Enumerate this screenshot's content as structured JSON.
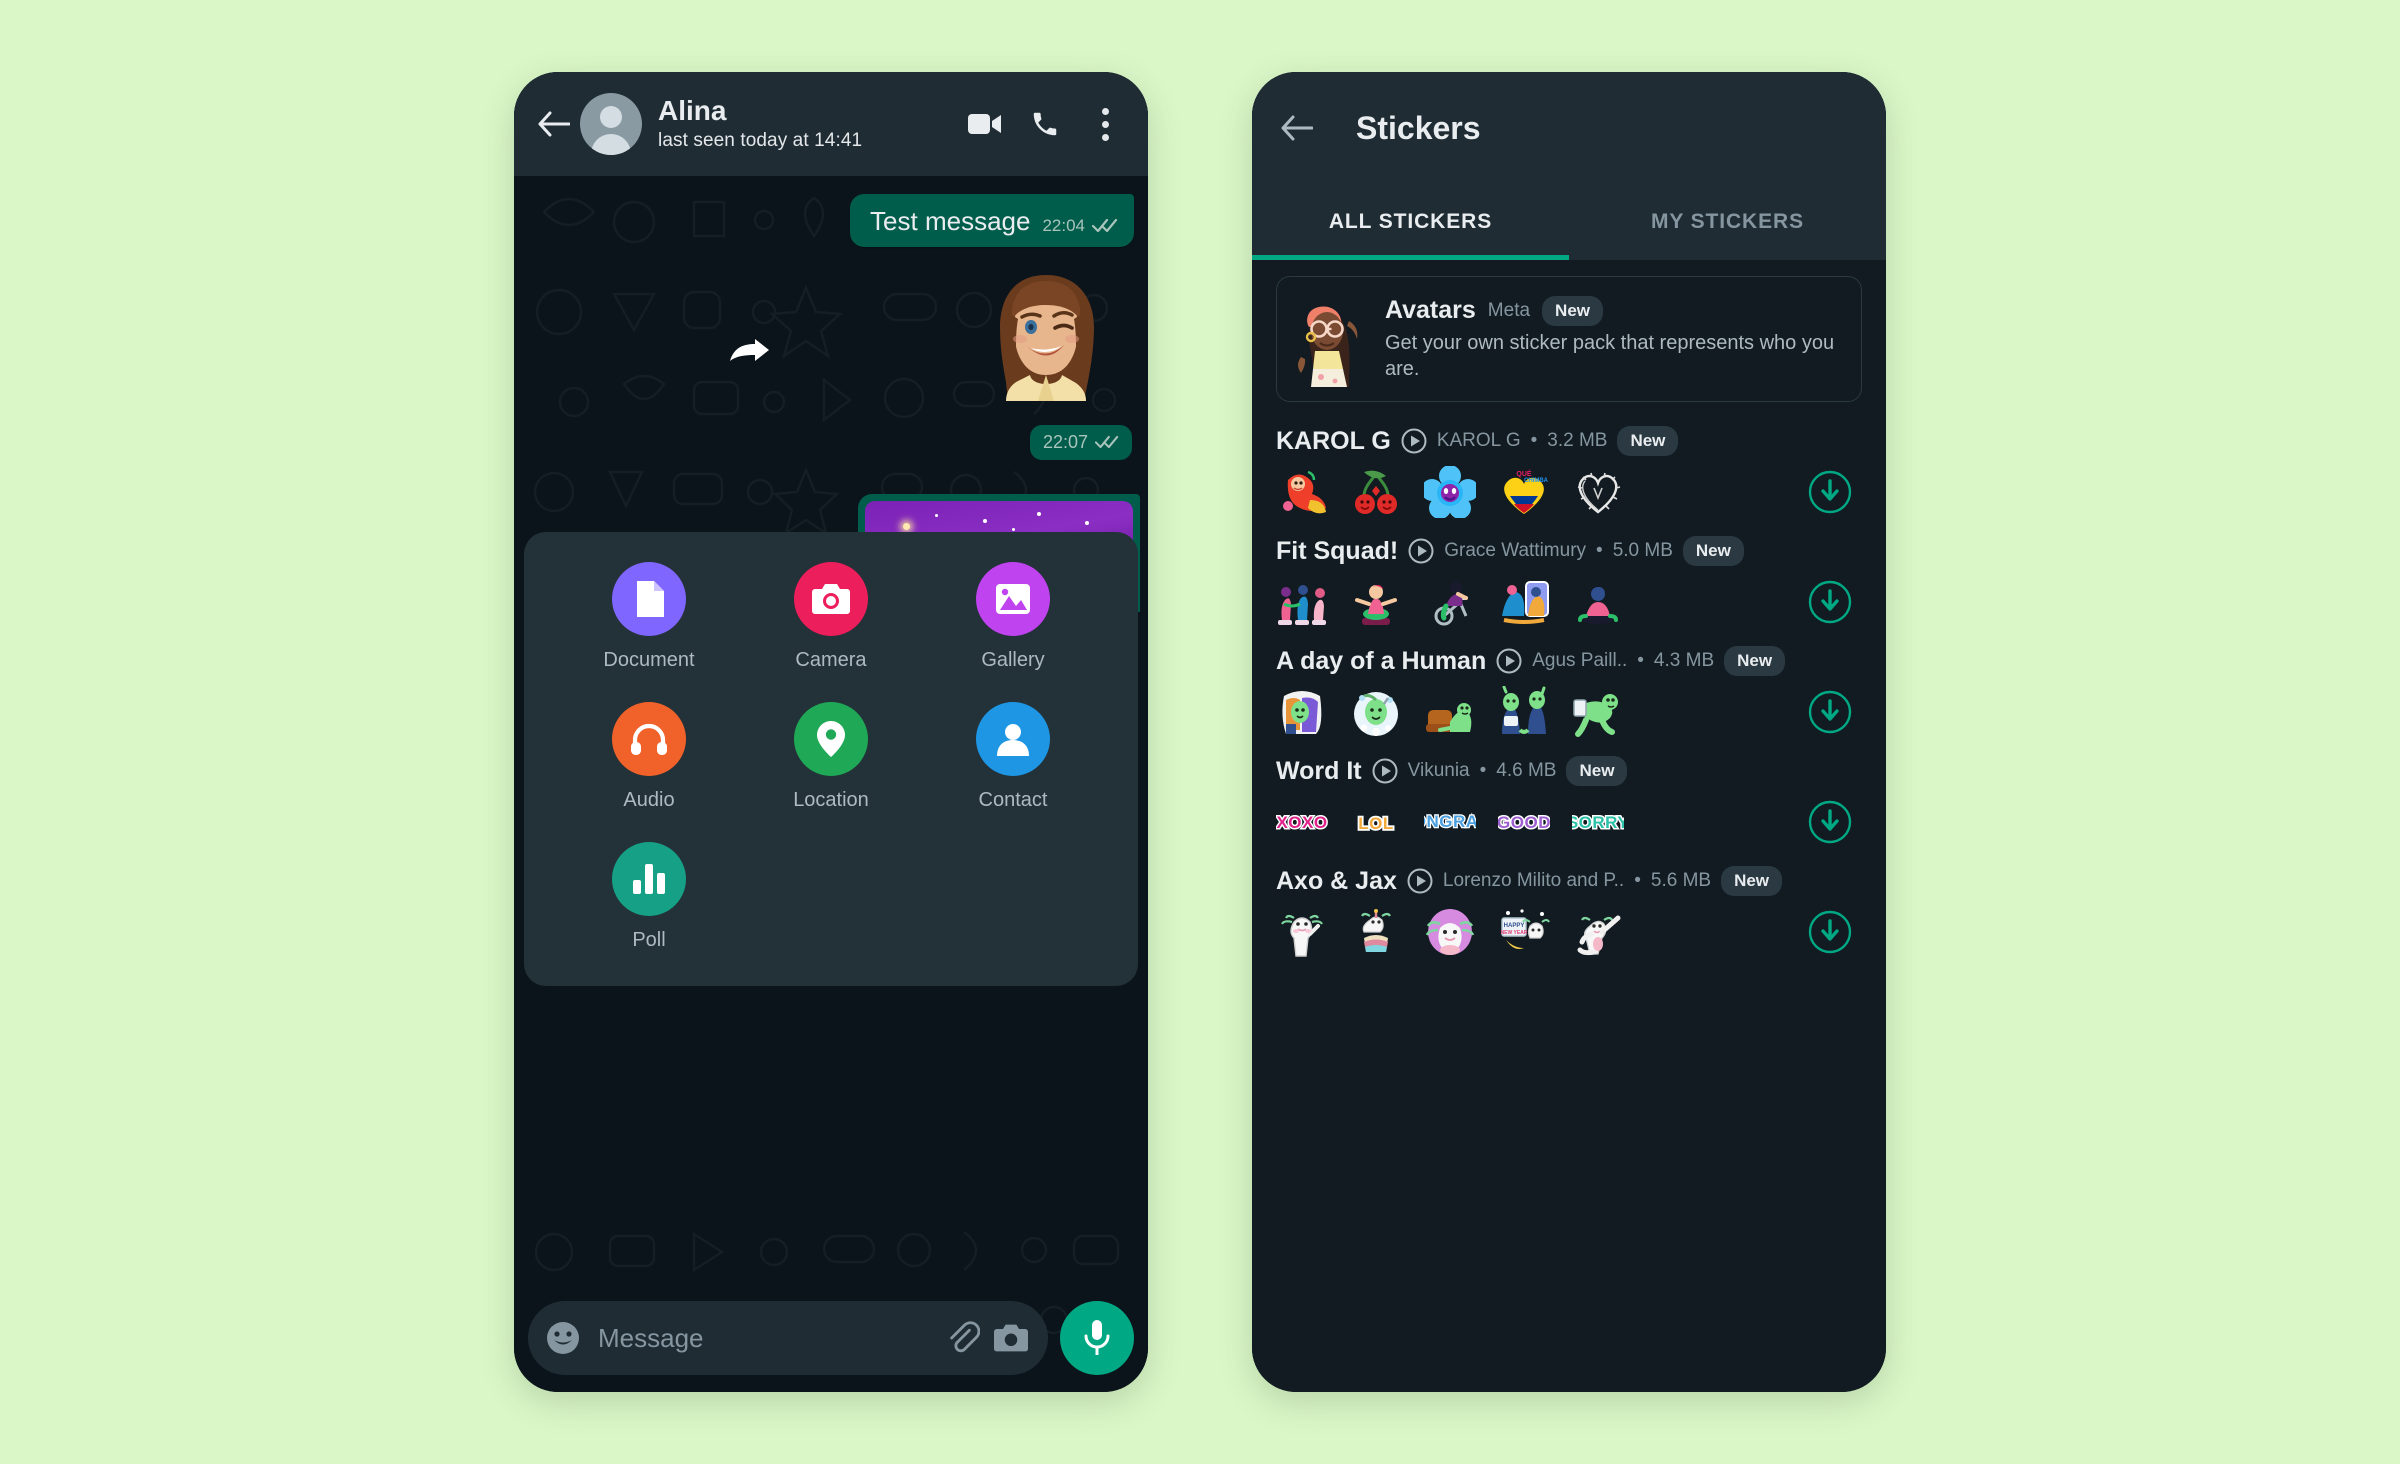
{
  "background_color": "#daf7c8",
  "chat": {
    "header": {
      "back_icon": "arrow-left-icon",
      "avatar": "contact-avatar",
      "name": "Alina",
      "status": "last seen today at 14:41",
      "video_call_icon": "video-camera-icon",
      "voice_call_icon": "phone-icon",
      "menu_icon": "kebab-menu-icon"
    },
    "messages": [
      {
        "type": "text",
        "text": "Test message",
        "time": "22:04",
        "status": "read",
        "outgoing": true
      },
      {
        "type": "sticker",
        "sticker": "avatar-sticker-wink",
        "time": "22:07",
        "status": "read",
        "outgoing": true,
        "forwarded_icon": "forward-arrow-icon"
      },
      {
        "type": "image",
        "image": "purple-starry-night-photo",
        "outgoing": true
      }
    ],
    "attachment_menu": {
      "items": [
        {
          "label": "Document",
          "icon": "document-icon",
          "color": "#7f66ff"
        },
        {
          "label": "Camera",
          "icon": "camera-icon",
          "color": "#ec1e5b"
        },
        {
          "label": "Gallery",
          "icon": "gallery-icon",
          "color": "#c043f0"
        },
        {
          "label": "Audio",
          "icon": "headphones-icon",
          "color": "#f1622a"
        },
        {
          "label": "Location",
          "icon": "location-pin-icon",
          "color": "#1fa855"
        },
        {
          "label": "Contact",
          "icon": "contact-person-icon",
          "color": "#1e96e4"
        },
        {
          "label": "Poll",
          "icon": "poll-bar-chart-icon",
          "color": "#16a085"
        }
      ]
    },
    "input_bar": {
      "emoji_icon": "emoji-smiley-icon",
      "placeholder": "Message",
      "attach_icon": "paperclip-icon",
      "camera_icon": "camera-icon",
      "mic_icon": "microphone-icon",
      "mic_color": "#00a884"
    }
  },
  "stickers": {
    "header": {
      "back_icon": "arrow-left-icon",
      "title": "Stickers"
    },
    "tabs": [
      {
        "label": "ALL STICKERS",
        "active": true
      },
      {
        "label": "MY STICKERS",
        "active": false
      }
    ],
    "accent_color": "#00a884",
    "avatars_card": {
      "thumb": "avatar-girl-thumbnail",
      "title": "Avatars",
      "publisher": "Meta",
      "badge": "New",
      "description": "Get your own sticker pack that represents who you are."
    },
    "packs": [
      {
        "name": "KAROL G",
        "play_icon": "play-circle-icon",
        "author": "KAROL G",
        "separator": "•",
        "size": "3.2 MB",
        "badge": "New",
        "download_icon": "download-circle-icon",
        "thumbs": [
          "mermaid-sticker",
          "cherries-sticker",
          "blue-flower-sticker",
          "que-chimba-heart-sticker",
          "thorn-heart-sticker"
        ]
      },
      {
        "name": "Fit Squad!",
        "play_icon": "play-circle-icon",
        "author": "Grace Wattimury",
        "separator": "•",
        "size": "5.0 MB",
        "badge": "New",
        "download_icon": "download-circle-icon",
        "thumbs": [
          "gym-trio-sticker",
          "stretching-sticker",
          "spin-bike-sticker",
          "phone-workout-sticker",
          "yoga-sticker"
        ]
      },
      {
        "name": "A day of a Human",
        "play_icon": "play-circle-icon",
        "author": "Agus Paill..",
        "separator": "•",
        "size": "4.3 MB",
        "badge": "New",
        "download_icon": "download-circle-icon",
        "thumbs": [
          "green-person-bus-sticker",
          "green-person-shower-sticker",
          "green-person-sofa-sticker",
          "green-people-pair-sticker",
          "green-person-running-sticker"
        ]
      },
      {
        "name": "Word It",
        "play_icon": "play-circle-icon",
        "author": "Vikunia",
        "separator": "•",
        "size": "4.6 MB",
        "badge": "New",
        "download_icon": "download-circle-icon",
        "thumbs": [
          "XOXO",
          "LOL",
          "CONGRATS",
          "GOOD",
          "SORRY"
        ]
      },
      {
        "name": "Axo & Jax",
        "play_icon": "play-circle-icon",
        "author": "Lorenzo Milito and P..",
        "separator": "•",
        "size": "5.6 MB",
        "badge": "New",
        "download_icon": "download-circle-icon",
        "thumbs": [
          "axolotl-wave-sticker",
          "axolotl-cake-sticker",
          "axolotl-pink-circle-sticker",
          "happy-new-year-sticker",
          "axolotl-dab-sticker"
        ]
      }
    ]
  }
}
